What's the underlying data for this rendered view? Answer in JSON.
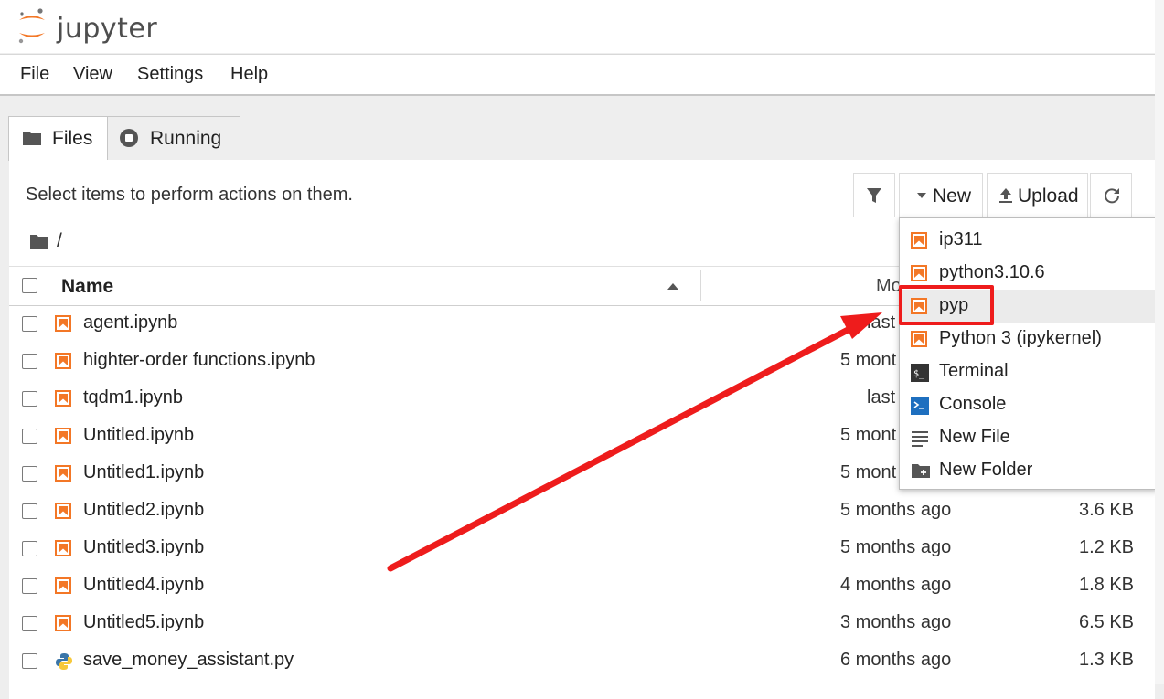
{
  "app": {
    "logo_text": "jupyter"
  },
  "menu": {
    "items": [
      "File",
      "View",
      "Settings",
      "Help"
    ]
  },
  "tabs": [
    {
      "label": "Files",
      "icon": "folder-icon",
      "active": true
    },
    {
      "label": "Running",
      "icon": "stop-circle-icon",
      "active": false
    }
  ],
  "toolbar": {
    "hint": "Select items to perform actions on them.",
    "filter_icon": "filter-icon",
    "new_label": "New",
    "upload_label": "Upload",
    "refresh_icon": "refresh-icon"
  },
  "breadcrumb": {
    "path": "/"
  },
  "table": {
    "columns": {
      "name": "Name",
      "modified": "Mo"
    },
    "rows": [
      {
        "name": "agent.ipynb",
        "icon": "notebook-icon",
        "modified": "last",
        "size": ""
      },
      {
        "name": "highter-order functions.ipynb",
        "icon": "notebook-icon",
        "modified": "5 mont",
        "size": ""
      },
      {
        "name": "tqdm1.ipynb",
        "icon": "notebook-icon",
        "modified": "last",
        "size": ""
      },
      {
        "name": "Untitled.ipynb",
        "icon": "notebook-icon",
        "modified": "5 mont",
        "size": ""
      },
      {
        "name": "Untitled1.ipynb",
        "icon": "notebook-icon",
        "modified": "5 mont",
        "size": ""
      },
      {
        "name": "Untitled2.ipynb",
        "icon": "notebook-icon",
        "modified": "5 months ago",
        "size": "3.6 KB"
      },
      {
        "name": "Untitled3.ipynb",
        "icon": "notebook-icon",
        "modified": "5 months ago",
        "size": "1.2 KB"
      },
      {
        "name": "Untitled4.ipynb",
        "icon": "notebook-icon",
        "modified": "4 months ago",
        "size": "1.8 KB"
      },
      {
        "name": "Untitled5.ipynb",
        "icon": "notebook-icon",
        "modified": "3 months ago",
        "size": "6.5 KB"
      },
      {
        "name": "save_money_assistant.py",
        "icon": "python-icon",
        "modified": "6 months ago",
        "size": "1.3 KB"
      }
    ]
  },
  "new_menu": {
    "items": [
      {
        "label": "ip311",
        "icon": "notebook-icon"
      },
      {
        "label": "python3.10.6",
        "icon": "notebook-icon"
      },
      {
        "label": "pyp",
        "icon": "notebook-icon",
        "highlighted": true
      },
      {
        "label": "Python 3 (ipykernel)",
        "icon": "notebook-icon"
      },
      {
        "label": "Terminal",
        "icon": "terminal-icon"
      },
      {
        "label": "Console",
        "icon": "console-icon"
      },
      {
        "label": "New File",
        "icon": "text-file-icon"
      },
      {
        "label": "New Folder",
        "icon": "new-folder-icon"
      }
    ]
  },
  "annotation": {
    "color": "#ee1c1c"
  },
  "colors": {
    "notebook_orange": "#f37726",
    "accent_red": "#ee1c1c"
  }
}
